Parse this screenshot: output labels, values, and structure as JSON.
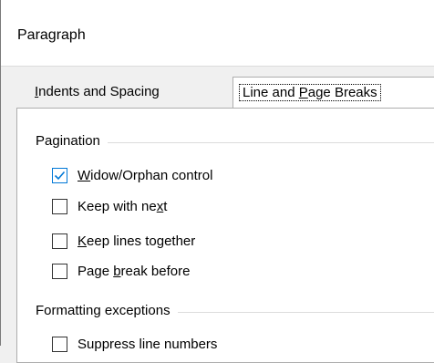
{
  "dialog": {
    "title": "Paragraph"
  },
  "tabs": [
    {
      "pre": "",
      "mnemonic": "I",
      "post": "ndents and Spacing",
      "active": false
    },
    {
      "pre": "Line and ",
      "mnemonic": "P",
      "post": "age Breaks",
      "active": true
    }
  ],
  "pagination": {
    "title": "Pagination",
    "items": [
      {
        "pre": "",
        "mnemonic": "W",
        "post": "idow/Orphan control",
        "checked": true
      },
      {
        "pre": "Keep with ne",
        "mnemonic": "x",
        "post": "t",
        "checked": false
      },
      {
        "pre": "",
        "mnemonic": "K",
        "post": "eep lines together",
        "checked": false
      },
      {
        "pre": "Page ",
        "mnemonic": "b",
        "post": "reak before",
        "checked": false
      }
    ]
  },
  "formatting": {
    "title": "Formatting exceptions",
    "items": [
      {
        "label": "Suppress line numbers",
        "checked": false
      }
    ]
  }
}
